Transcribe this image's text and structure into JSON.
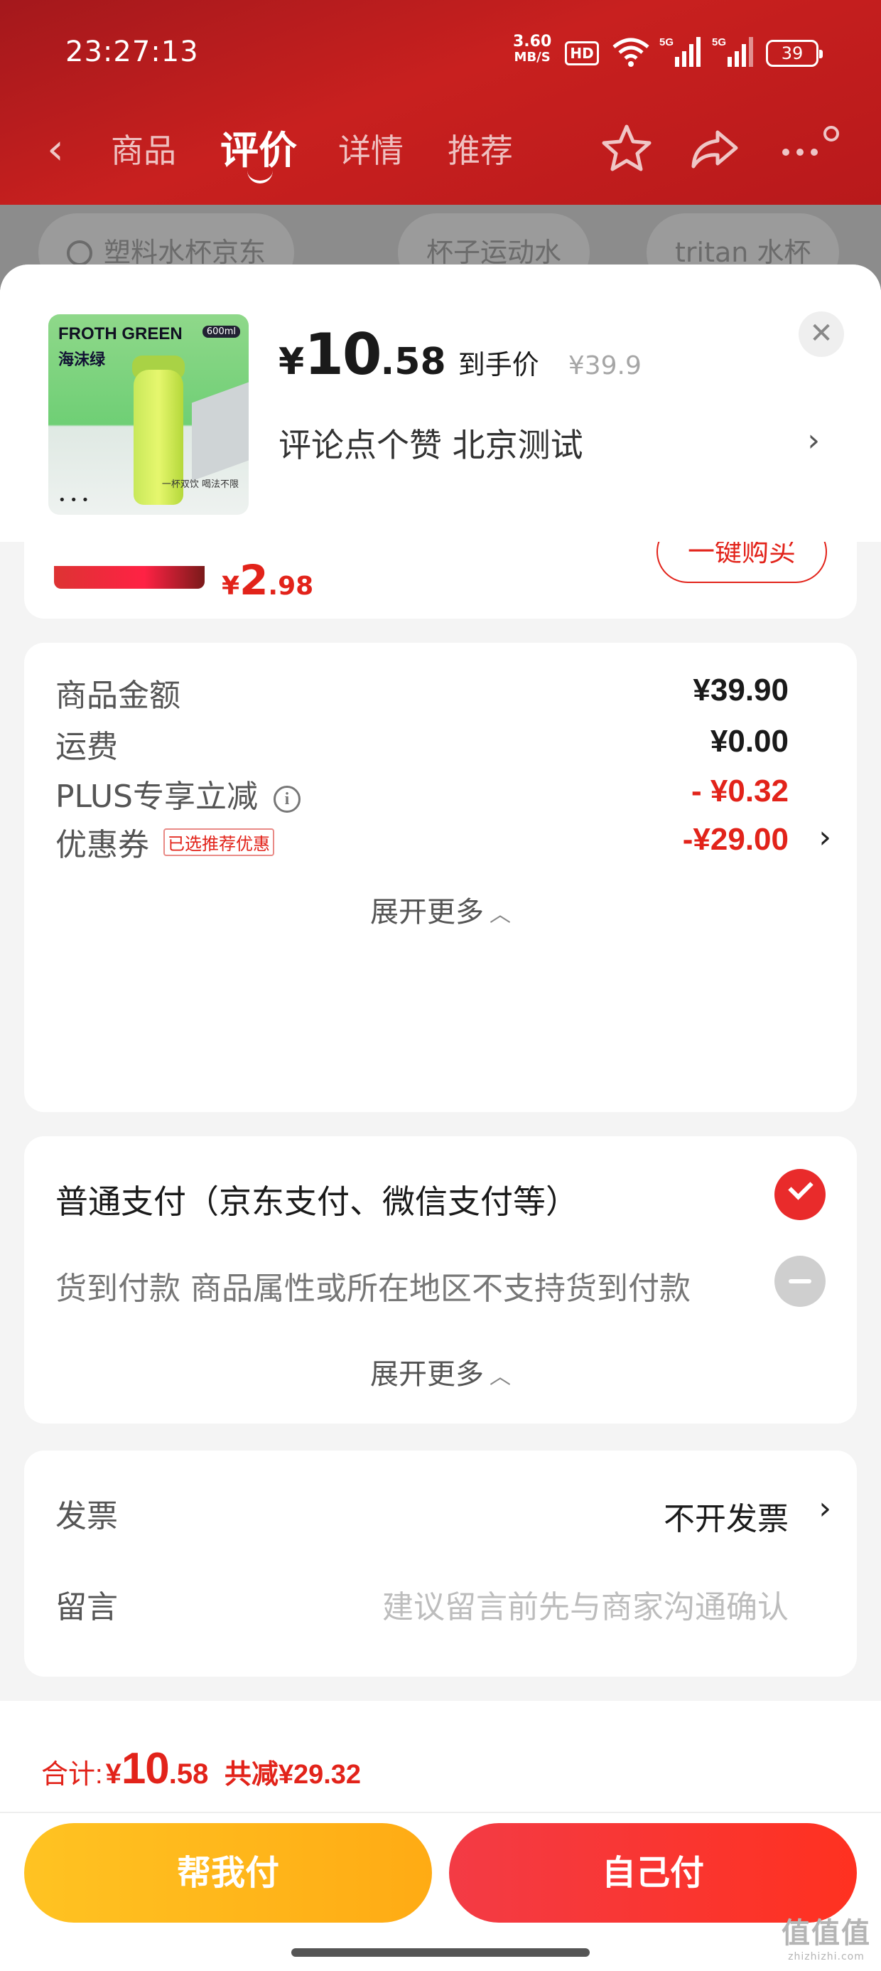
{
  "status_bar": {
    "time": "23:27:13",
    "net_speed": "3.60",
    "net_unit": "MB/S",
    "hd": "HD",
    "battery": "39"
  },
  "nav": {
    "tabs": [
      {
        "label": "商品"
      },
      {
        "label": "评价"
      },
      {
        "label": "详情"
      },
      {
        "label": "推荐"
      }
    ]
  },
  "background_search_chips": [
    {
      "label": "塑料水杯京东"
    },
    {
      "label": "杯子运动水"
    },
    {
      "label": "tritan 水杯"
    }
  ],
  "product": {
    "thumb_brand": "FROTH GREEN",
    "thumb_color": "海沫绿",
    "thumb_volume": "600ml",
    "thumb_dots": "• • •",
    "thumb_tag": "一杯双饮 喝法不限",
    "price_symbol": "¥",
    "price_int": "10",
    "price_dec": ".58",
    "price_label": "到手价",
    "original_price": "¥39.9",
    "spec": "评论点个赞  北京测试"
  },
  "recommend": {
    "price_symbol": "¥",
    "price_int": "2",
    "price_dec": ".98",
    "buy_label": "一键购买"
  },
  "summary": {
    "rows": [
      {
        "label": "商品金额",
        "value": "¥39.90"
      },
      {
        "label": "运费",
        "value": "¥0.00"
      },
      {
        "label": "PLUS专享立减",
        "value": "- ¥0.32"
      },
      {
        "label": "优惠券",
        "badge": "已选推荐优惠",
        "value": "-¥29.00"
      }
    ],
    "more_label": "展开更多"
  },
  "payment": {
    "options": [
      {
        "label": "普通支付（京东支付、微信支付等）"
      },
      {
        "label": "货到付款 商品属性或所在地区不支持货到付款"
      }
    ],
    "more_label": "展开更多"
  },
  "invoice": {
    "label": "发票",
    "value": "不开发票"
  },
  "message": {
    "label": "留言",
    "placeholder": "建议留言前先与商家沟通确认"
  },
  "footer": {
    "total_label": "合计:",
    "total_symbol": "¥",
    "total_int": "10",
    "total_dec": ".58",
    "saved": "共减¥29.32",
    "help_pay_label": "帮我付",
    "self_pay_label": "自己付"
  },
  "watermark": {
    "logo": "值值值",
    "site": "zhizhizhi.com"
  },
  "colors": {
    "header_red": "#c8201f",
    "price_red": "#e2231a",
    "help_button": "#ffb51a",
    "self_button": "#f5333a"
  },
  "icons": [
    "back-icon",
    "star-icon",
    "share-icon",
    "more-icon",
    "search-icon",
    "close-icon",
    "chevron-right-icon",
    "info-icon",
    "check-icon",
    "disabled-icon",
    "chevron-down-icon"
  ]
}
